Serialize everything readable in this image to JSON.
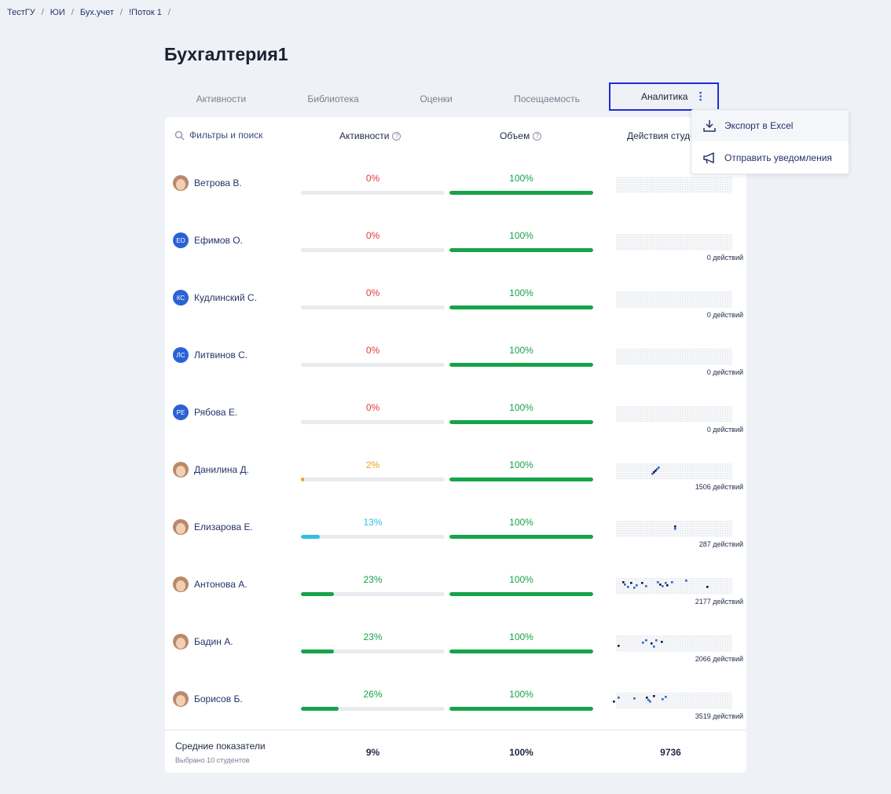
{
  "breadcrumb": [
    "ТестГУ",
    "ЮИ",
    "Бух.учет",
    "!Поток 1"
  ],
  "title": "Бухгалтерия1",
  "tabs": [
    "Активности",
    "Библиотека",
    "Оценки",
    "Посещаемость",
    "Аналитика"
  ],
  "search": "Фильтры и поиск",
  "columns": {
    "activity": "Активности",
    "volume": "Объем",
    "students": "Действия студентов"
  },
  "menu": {
    "export": "Экспорт в Excel",
    "notify": "Отправить уведомления"
  },
  "colors": {
    "green": "#16a34a",
    "red": "#e53935",
    "orange": "#f0a020",
    "cyan": "#2ec0e0",
    "accent": "#1f2bd9"
  },
  "students": [
    {
      "name": "Ветрова В.",
      "avatar": "photo",
      "activity": "0%",
      "activity_value": 0,
      "activity_color": "red",
      "volume": "100%",
      "volume_value": 100,
      "actions": ""
    },
    {
      "name": "Ефимов О.",
      "avatar": "ЕО",
      "activity": "0%",
      "activity_value": 0,
      "activity_color": "red",
      "volume": "100%",
      "volume_value": 100,
      "actions": "0 действий"
    },
    {
      "name": "Кудлинский С.",
      "avatar": "КС",
      "activity": "0%",
      "activity_value": 0,
      "activity_color": "red",
      "volume": "100%",
      "volume_value": 100,
      "actions": "0 действий"
    },
    {
      "name": "Литвинов С.",
      "avatar": "ЛС",
      "activity": "0%",
      "activity_value": 0,
      "activity_color": "red",
      "volume": "100%",
      "volume_value": 100,
      "actions": "0 действий"
    },
    {
      "name": "Рябова Е.",
      "avatar": "РЕ",
      "activity": "0%",
      "activity_value": 0,
      "activity_color": "red",
      "volume": "100%",
      "volume_value": 100,
      "actions": "0 действий"
    },
    {
      "name": "Данилина Д.",
      "avatar": "photo",
      "activity": "2%",
      "activity_value": 2,
      "activity_color": "orange",
      "volume": "100%",
      "volume_value": 100,
      "actions": "1506 действий"
    },
    {
      "name": "Елизарова Е.",
      "avatar": "photo",
      "activity": "13%",
      "activity_value": 13,
      "activity_color": "cyan",
      "volume": "100%",
      "volume_value": 100,
      "actions": "287 действий"
    },
    {
      "name": "Антонова А.",
      "avatar": "photo",
      "activity": "23%",
      "activity_value": 23,
      "activity_color": "green",
      "volume": "100%",
      "volume_value": 100,
      "actions": "2177 действий"
    },
    {
      "name": "Бадин А.",
      "avatar": "photo",
      "activity": "23%",
      "activity_value": 23,
      "activity_color": "green",
      "volume": "100%",
      "volume_value": 100,
      "actions": "2066 действий"
    },
    {
      "name": "Борисов Б.",
      "avatar": "photo",
      "activity": "26%",
      "activity_value": 26,
      "activity_color": "green",
      "volume": "100%",
      "volume_value": 100,
      "actions": "3519 действий"
    }
  ],
  "footer": {
    "label": "Средние показатели",
    "sub": "Выбрано 10 студентов",
    "activity": "9%",
    "volume": "100%",
    "actions": "9736"
  }
}
